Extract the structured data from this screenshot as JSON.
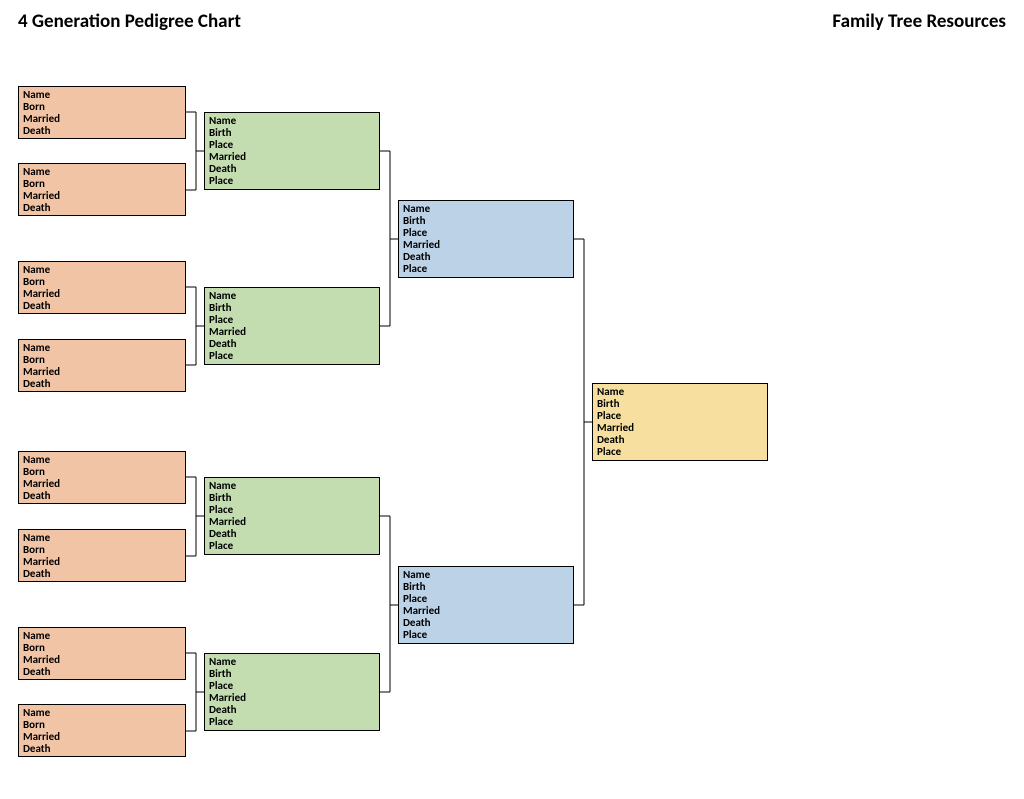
{
  "header": {
    "title": "4 Generation Pedigree Chart",
    "brand": "Family Tree Resources"
  },
  "labels": {
    "short": [
      "Name",
      "Born",
      "Married",
      "Death"
    ],
    "long": [
      "Name",
      "Birth",
      "Place",
      "Married",
      "Death",
      "Place"
    ]
  },
  "colors": {
    "gen4": "#f2c4a6",
    "gen3": "#c3dcb0",
    "gen2": "#bcd2e6",
    "gen1": "#f7df9f"
  },
  "structure": {
    "generations": 4,
    "boxes_per_generation": [
      1,
      2,
      4,
      8
    ]
  }
}
